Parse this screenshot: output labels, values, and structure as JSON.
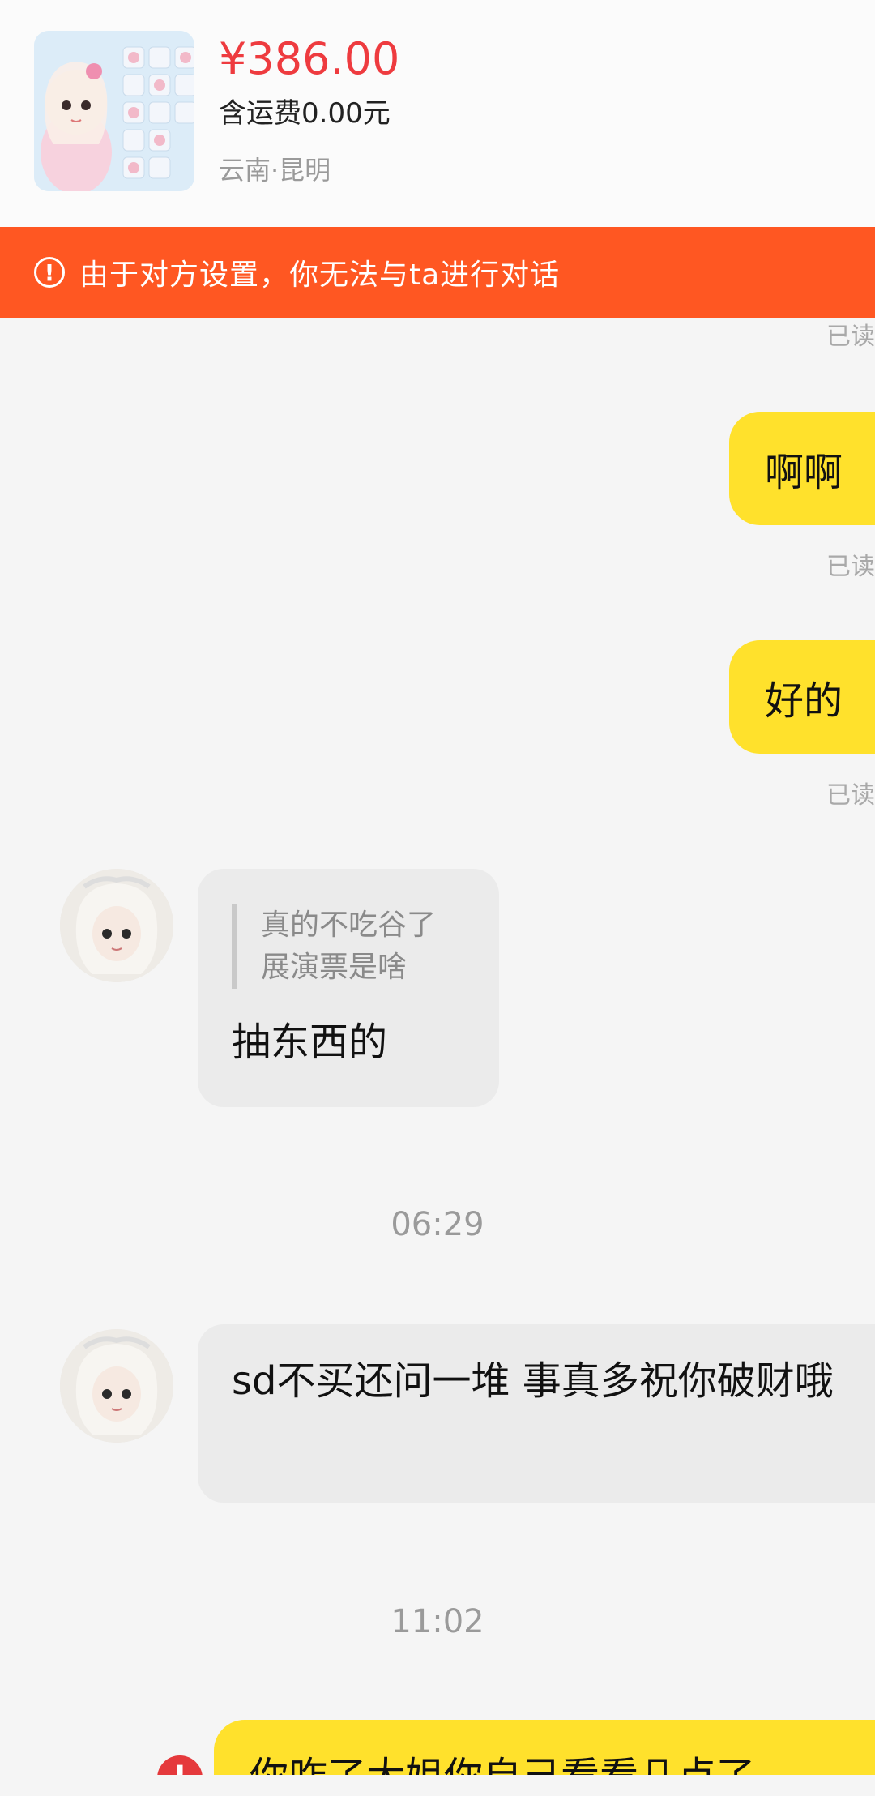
{
  "product": {
    "price": "¥386.00",
    "shipping": "含运费0.00元",
    "location": "云南·昆明"
  },
  "alert": {
    "icon": "info-icon",
    "text": "由于对方设置，你无法与ta进行对话"
  },
  "messages": {
    "read_label": "已读",
    "out1": "啊啊",
    "out2": "好的",
    "in1_quote_line1": "真的不吃谷了",
    "in1_quote_line2": "展演票是啥",
    "in1_text": "抽东西的",
    "time1": "06:29",
    "in2_text": "sd不买还问一堆 事真多祝你破财哦",
    "time2": "11:02",
    "out3": "你咋了大姐你自己看看几点了"
  },
  "colors": {
    "accent_orange": "#ff5722",
    "bubble_out": "#ffe12c",
    "bubble_in": "#ebebeb",
    "price_red": "#ee3b3f"
  }
}
